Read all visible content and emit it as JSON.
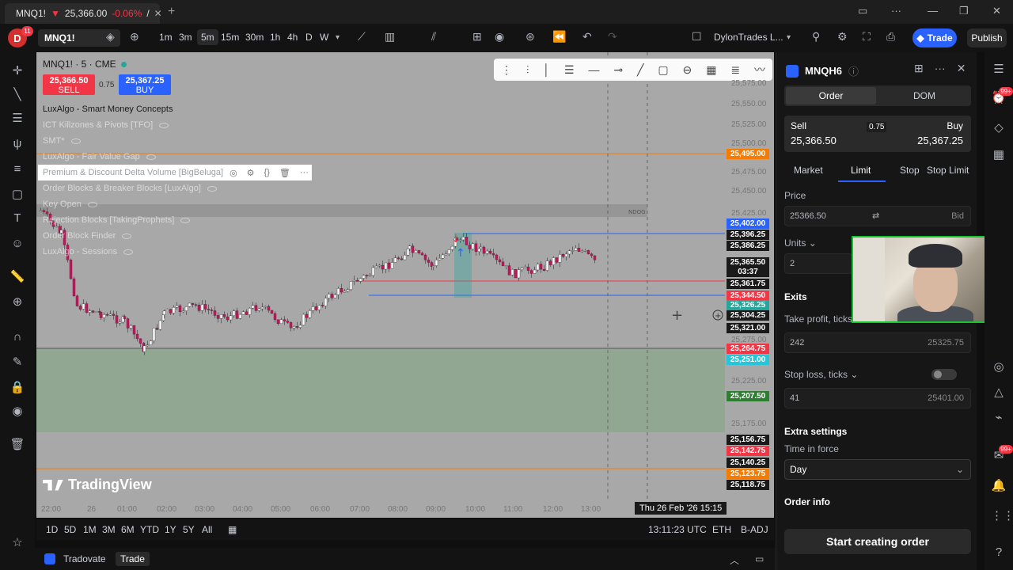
{
  "browser": {
    "tab_title": "MNQ1!",
    "tab_price": "25,366.00",
    "tab_change": "-0.06%",
    "tab_sep": "/"
  },
  "toolbar": {
    "avatar_letter": "D",
    "avatar_badge": "11",
    "symbol": "MNQ1!",
    "intervals": [
      "1m",
      "3m",
      "5m",
      "15m",
      "30m",
      "1h",
      "4h",
      "D",
      "W"
    ],
    "active_interval": "5m",
    "layout_name": "DylonTrades L...",
    "trade_label": "Trade",
    "publish_label": "Publish"
  },
  "chart": {
    "title": "MNQ1! · 5 · CME",
    "sell_price": "25,366.50",
    "sell_label": "SELL",
    "spread": "0.75",
    "buy_price": "25,367.25",
    "buy_label": "BUY",
    "indicators": [
      "LuxAlgo - Smart Money Concepts",
      "ICT Killzones & Pivots [TFO]",
      "SMT*",
      "LuxAlgo - Fair Value Gap",
      "Premium & Discount Delta Volume [BigBeluga]",
      "Order Blocks & Breaker Blocks [LuxAlgo]",
      "Key Open",
      "Rejection Blocks [TakingProphets]",
      "Order Block Finder",
      "LuxAlgo - Sessions"
    ],
    "price_labels": [
      {
        "price": "25,495.00",
        "color": "#f57c00"
      },
      {
        "price": "25,402.00",
        "color": "#2962ff"
      },
      {
        "price": "25,396.25",
        "color": "#1a1a1a"
      },
      {
        "price": "25,386.25",
        "color": "#1a1a1a"
      },
      {
        "price": "25,365.50",
        "color": "#1a1a1a"
      },
      {
        "price": "03:37",
        "color": "#1a1a1a"
      },
      {
        "price": "25,361.75",
        "color": "#1a1a1a"
      },
      {
        "price": "25,344.50",
        "color": "#f23645"
      },
      {
        "price": "25,326.25",
        "color": "#26a69a"
      },
      {
        "price": "25,304.25",
        "color": "#1a1a1a"
      },
      {
        "price": "25,321.00",
        "color": "#1a1a1a"
      },
      {
        "price": "25,264.75",
        "color": "#f23645"
      },
      {
        "price": "25,251.00",
        "color": "#26c6da"
      },
      {
        "price": "25,207.50",
        "color": "#2e7d32"
      },
      {
        "price": "25,156.75",
        "color": "#1a1a1a"
      },
      {
        "price": "25,142.75",
        "color": "#f23645"
      },
      {
        "price": "25,140.25",
        "color": "#1a1a1a"
      },
      {
        "price": "25,123.75",
        "color": "#f57c00"
      },
      {
        "price": "25,118.75",
        "color": "#1a1a1a"
      }
    ],
    "axis_prices": [
      "25,575.00",
      "25,550.00",
      "25,525.00",
      "25,500.00",
      "25,475.00",
      "25,450.00",
      "25,425.00",
      "25,275.00",
      "25,225.00",
      "25,175.00"
    ],
    "time_labels": [
      "22:00",
      "26",
      "01:00",
      "02:00",
      "03:00",
      "04:00",
      "05:00",
      "06:00",
      "07:00",
      "08:00",
      "09:00",
      "10:00",
      "11:00",
      "12:00",
      "13:00"
    ],
    "cursor_time": "Thu 26 Feb '26   15:15",
    "brand": "TradingView",
    "ndog_label": "NDOG"
  },
  "bottom": {
    "ranges": [
      "1D",
      "5D",
      "1M",
      "3M",
      "6M",
      "YTD",
      "1Y",
      "5Y",
      "All"
    ],
    "clock": "13:11:23 UTC",
    "session": "ETH",
    "adj": "B-ADJ"
  },
  "status": {
    "broker": "Tradovate",
    "trade": "Trade"
  },
  "panel": {
    "symbol": "MNQH6",
    "tab_order": "Order",
    "tab_dom": "DOM",
    "sell_label": "Sell",
    "sell_price": "25,366.50",
    "buy_label": "Buy",
    "buy_price": "25,367.25",
    "spread": "0.75",
    "order_types": [
      "Market",
      "Limit",
      "Stop",
      "Stop Limit"
    ],
    "price_label": "Price",
    "price_value": "25366.50",
    "price_side": "Bid",
    "units_label": "Units",
    "units_value": "2",
    "exits_label": "Exits",
    "tp_label": "Take profit, ticks",
    "tp_ticks": "242",
    "tp_price": "25325.75",
    "sl_label": "Stop loss, ticks",
    "sl_ticks": "41",
    "sl_price": "25401.00",
    "extra_label": "Extra settings",
    "tif_label": "Time in force",
    "tif_value": "Day",
    "order_info_label": "Order info",
    "create_label": "Start creating order"
  },
  "rightbar": {
    "badge1": "99+",
    "badge2": "99+"
  }
}
